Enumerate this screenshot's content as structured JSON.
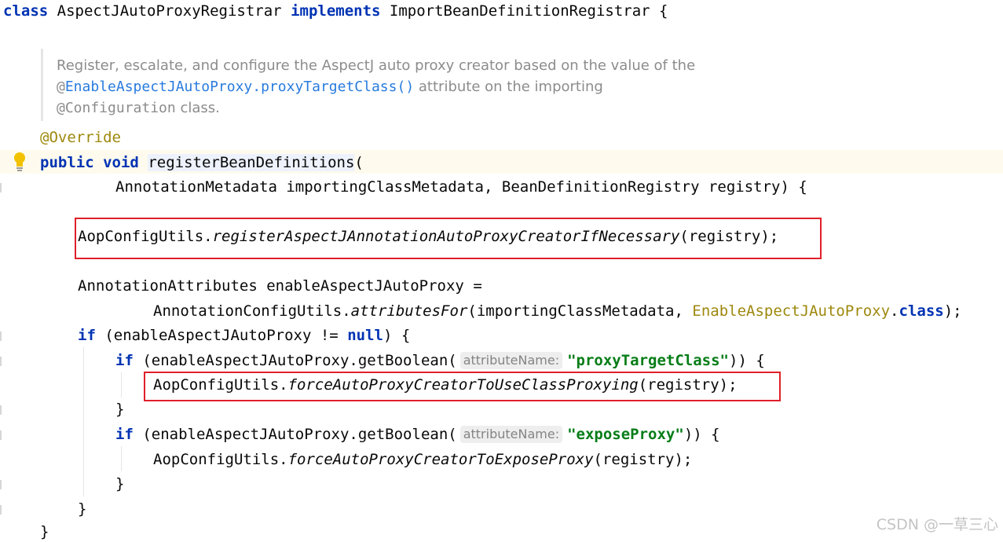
{
  "code": {
    "class_line": {
      "kw_class": "class",
      "class_name": " AspectJAutoProxyRegistrar ",
      "kw_implements": "implements",
      "iface": " ImportBeanDefinitionRegistrar {"
    },
    "javadoc": {
      "line1": "Register, escalate, and configure the AspectJ auto proxy creator based on the value of the",
      "line2_at": "@",
      "line2_link": "EnableAspectJAutoProxy.proxyTargetClass()",
      "line2_rest": " attribute on the importing",
      "line3_code": "@Configuration",
      "line3_rest": " class."
    },
    "override": "@Override",
    "method_sig": {
      "kw_public": "public",
      "kw_void": "void",
      "name": "registerBeanDefinitions",
      "paren": "("
    },
    "params": "AnnotationMetadata importingClassMetadata, BeanDefinitionRegistry registry) {",
    "register_call": {
      "receiver": "AopConfigUtils.",
      "method": "registerAspectJAnnotationAutoProxyCreatorIfNecessary",
      "args": "(registry);"
    },
    "attrs_decl": "AnnotationAttributes enableAspectJAutoProxy =",
    "attrs_init": {
      "receiver": "AnnotationConfigUtils.",
      "method": "attributesFor",
      "args": "(importingClassMetadata, ",
      "type": "EnableAspectJAutoProxy",
      "dot": ".",
      "kw_class": "class",
      "end": ");"
    },
    "if_null": {
      "kw_if": "if",
      "cond": " (enableAspectJAutoProxy != ",
      "kw_null": "null",
      "end": ") {"
    },
    "if_proxy": {
      "kw_if": "if",
      "call": " (enableAspectJAutoProxy.getBoolean(",
      "hint": "attributeName:",
      "str": "\"proxyTargetClass\"",
      "end": ")) {"
    },
    "force_proxy": {
      "receiver": "AopConfigUtils.",
      "method": "forceAutoProxyCreatorToUseClassProxying",
      "args": "(registry);"
    },
    "close_brace": "}",
    "if_expose": {
      "kw_if": "if",
      "call": " (enableAspectJAutoProxy.getBoolean(",
      "hint": "attributeName:",
      "str": "\"exposeProxy\"",
      "end": ")) {"
    },
    "force_expose": {
      "receiver": "AopConfigUtils.",
      "method": "forceAutoProxyCreatorToExposeProxy",
      "args": "(registry);"
    }
  },
  "watermark": "CSDN @一草三心",
  "colors": {
    "keyword": "#0033b3",
    "annotation": "#9e880d",
    "string": "#067d17",
    "doc": "#8c8c8c",
    "link": "#287bde",
    "highlight_box": "#e0202a"
  },
  "icons": [
    "intention-bulb-icon"
  ]
}
